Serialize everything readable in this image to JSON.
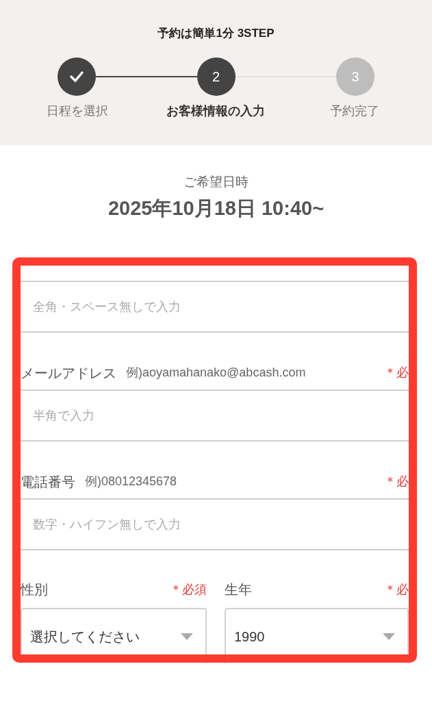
{
  "header": {
    "title": "予約は簡単1分 3STEP",
    "steps": [
      {
        "label": "日程を選択",
        "done": true,
        "selected": false
      },
      {
        "number": "2",
        "label": "お客様情報の入力",
        "done": false,
        "selected": true
      },
      {
        "number": "3",
        "label": "予約完了",
        "done": false,
        "selected": false
      }
    ]
  },
  "schedule": {
    "label": "ご希望日時",
    "value": "2025年10月18日 10:40~"
  },
  "form": {
    "fields": [
      {
        "kind": "text",
        "placeholder": "全角・スペース無しで入力"
      },
      {
        "kind": "text",
        "label": "メールアドレス",
        "example": "例)aoyamahanako@abcash.com",
        "required": "＊必",
        "placeholder": "半角で入力"
      },
      {
        "kind": "text",
        "label": "電話番号",
        "example": "例)08012345678",
        "required": "＊必",
        "placeholder": "数字・ハイフン無しで入力"
      },
      {
        "kind": "select_pair",
        "items": [
          {
            "label": "性別",
            "required": "＊必須",
            "value": "選択してください"
          },
          {
            "label": "生年",
            "required": "＊必",
            "value": "1990"
          }
        ]
      }
    ]
  }
}
